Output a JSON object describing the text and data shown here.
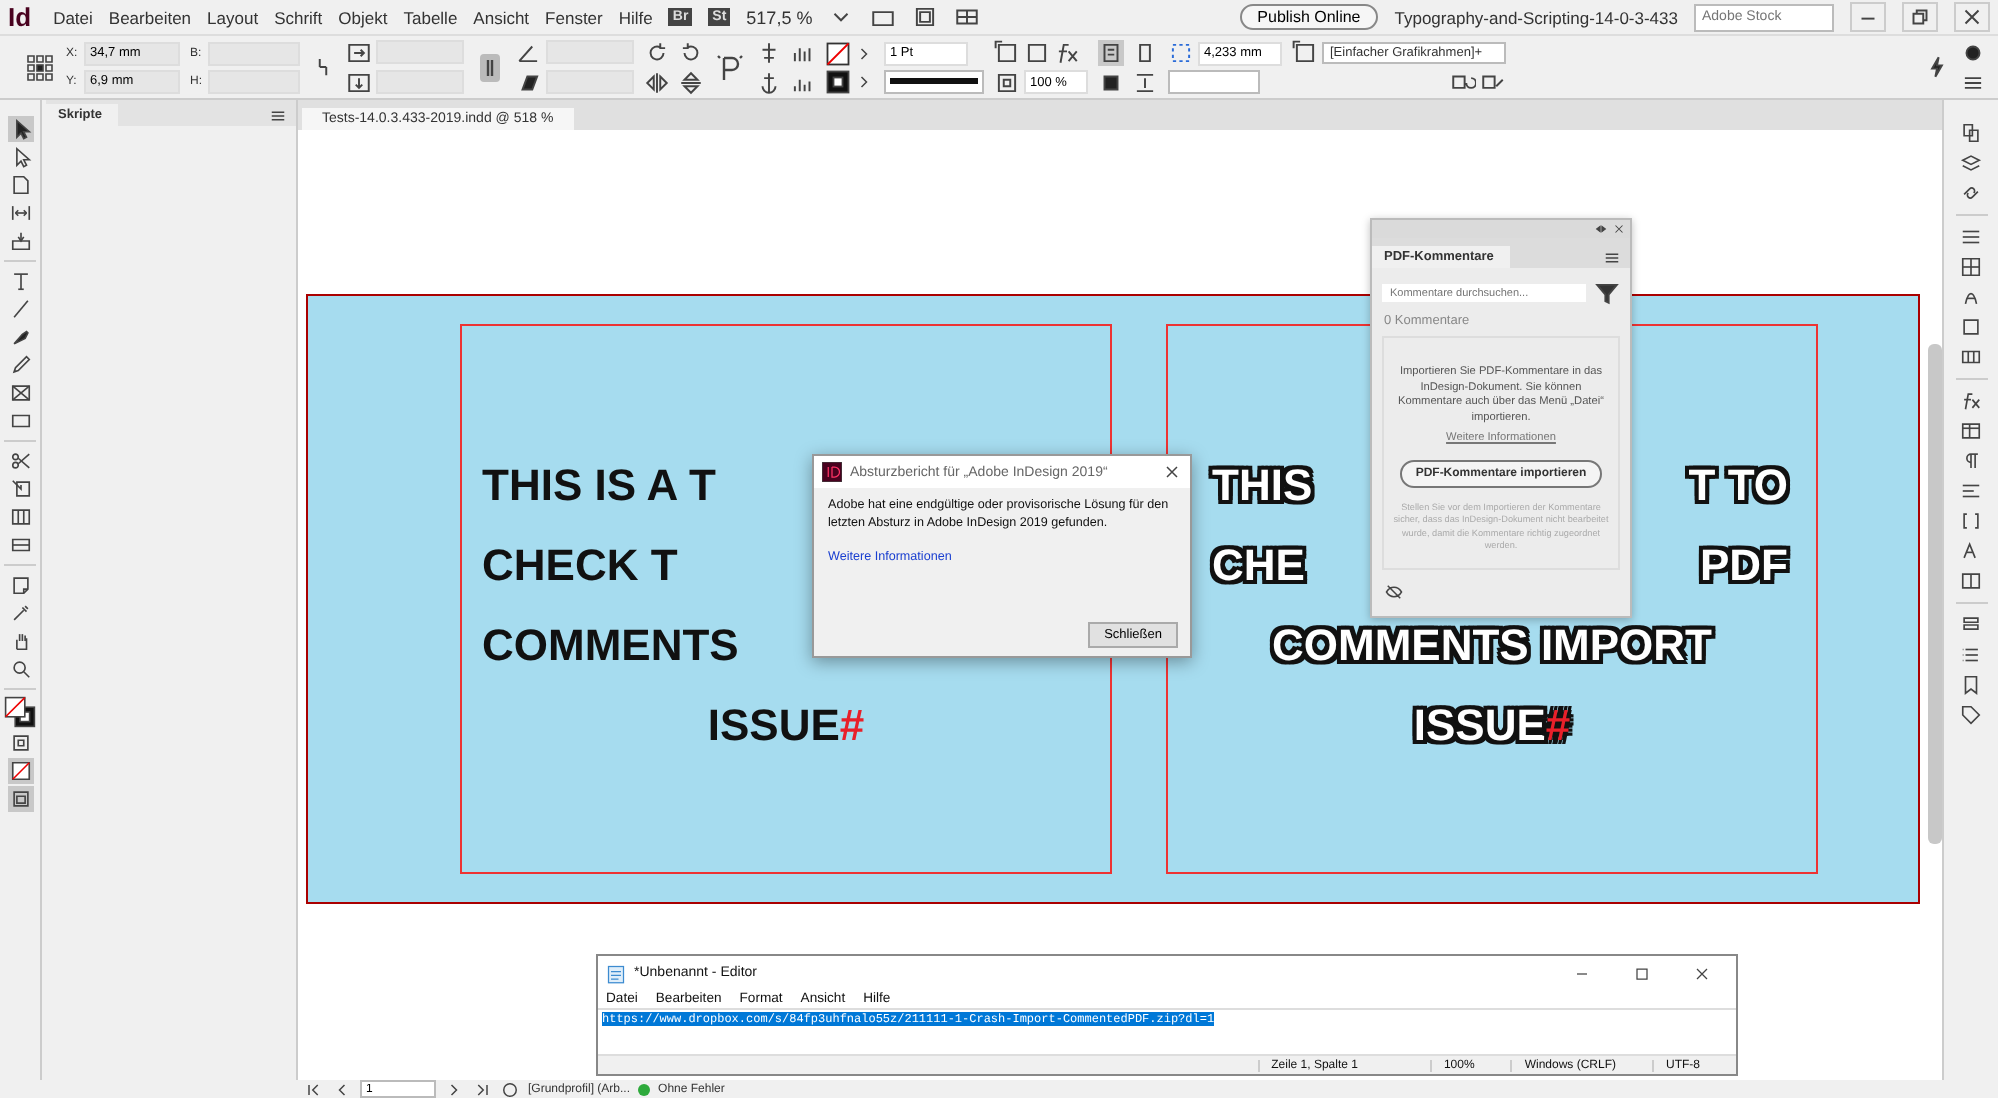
{
  "app": {
    "logo": "Id",
    "menu": [
      "Datei",
      "Bearbeiten",
      "Layout",
      "Schrift",
      "Objekt",
      "Tabelle",
      "Ansicht",
      "Fenster",
      "Hilfe"
    ],
    "bridge": "Br",
    "stock": "St",
    "zoom": "517,5 %",
    "publish": "Publish Online",
    "document_name": "Typography-and-Scripting-14-0-3-433",
    "search": {
      "placeholder": "Adobe Stock"
    }
  },
  "control_bar": {
    "x_label": "X:",
    "x": "34,7 mm",
    "y_label": "Y:",
    "y": "6,9 mm",
    "w_label": "B:",
    "h_label": "H:",
    "stroke_weight": "1 Pt",
    "opacity": "100 %",
    "offset": "4,233 mm",
    "object_style": "[Einfacher Grafikrahmen]+"
  },
  "scripts_panel": {
    "tab": "Skripte"
  },
  "document": {
    "tab": "Tests-14.0.3.433-2019.indd @ 518 %",
    "frames": [
      {
        "kind": "plain",
        "lines": [
          {
            "parts": [
              "THIS IS A T"
            ]
          },
          {
            "parts": [
              "CHECK T"
            ]
          },
          {
            "parts": [
              "COMMENTS"
            ]
          },
          {
            "parts": [
              "ISSUE"
            ],
            "mark": "#"
          }
        ]
      },
      {
        "kind": "outlined",
        "lines": [
          {
            "parts": [
              "THIS",
              "T TO"
            ]
          },
          {
            "parts": [
              "CHE",
              "PDF"
            ]
          },
          {
            "parts": [
              "COMMENTS IMPORT"
            ]
          },
          {
            "parts": [
              "ISSUE"
            ],
            "mark": "#"
          }
        ]
      }
    ]
  },
  "crash_dialog": {
    "title": "Absturzbericht für „Adobe InDesign 2019“",
    "message": "Adobe hat eine endgültige oder provisorische Lösung für den letzten Absturz in Adobe InDesign 2019 gefunden.",
    "link": "Weitere Informationen",
    "button": "Schließen"
  },
  "pdf_comments_panel": {
    "tab": "PDF-Kommentare",
    "search": {
      "placeholder": "Kommentare durchsuchen..."
    },
    "count": "0 Kommentare",
    "info": "Importieren Sie PDF-Kommentare in das InDesign-Dokument. Sie können Kommentare auch über das Menü „Datei“ importieren.",
    "link": "Weitere Informationen",
    "button": "PDF-Kommentare importieren",
    "note": "Stellen Sie vor dem Importieren der Kommentare sicher, dass das InDesign-Dokument nicht bearbeitet wurde, damit die Kommentare richtig zugeordnet werden."
  },
  "editor": {
    "title": "*Unbenannt - Editor",
    "menu": [
      "Datei",
      "Bearbeiten",
      "Format",
      "Ansicht",
      "Hilfe"
    ],
    "content": "https://www.dropbox.com/s/84fp3uhfnalo55z/211111-1-Crash-Import-CommentedPDF.zip?dl=1",
    "status": [
      "Zeile 1, Spalte 1",
      "100%",
      "Windows (CRLF)",
      "UTF-8"
    ]
  },
  "status_bar": {
    "page": "1",
    "profile": "[Grundprofil] (Arb...",
    "preflight": "Ohne Fehler"
  }
}
